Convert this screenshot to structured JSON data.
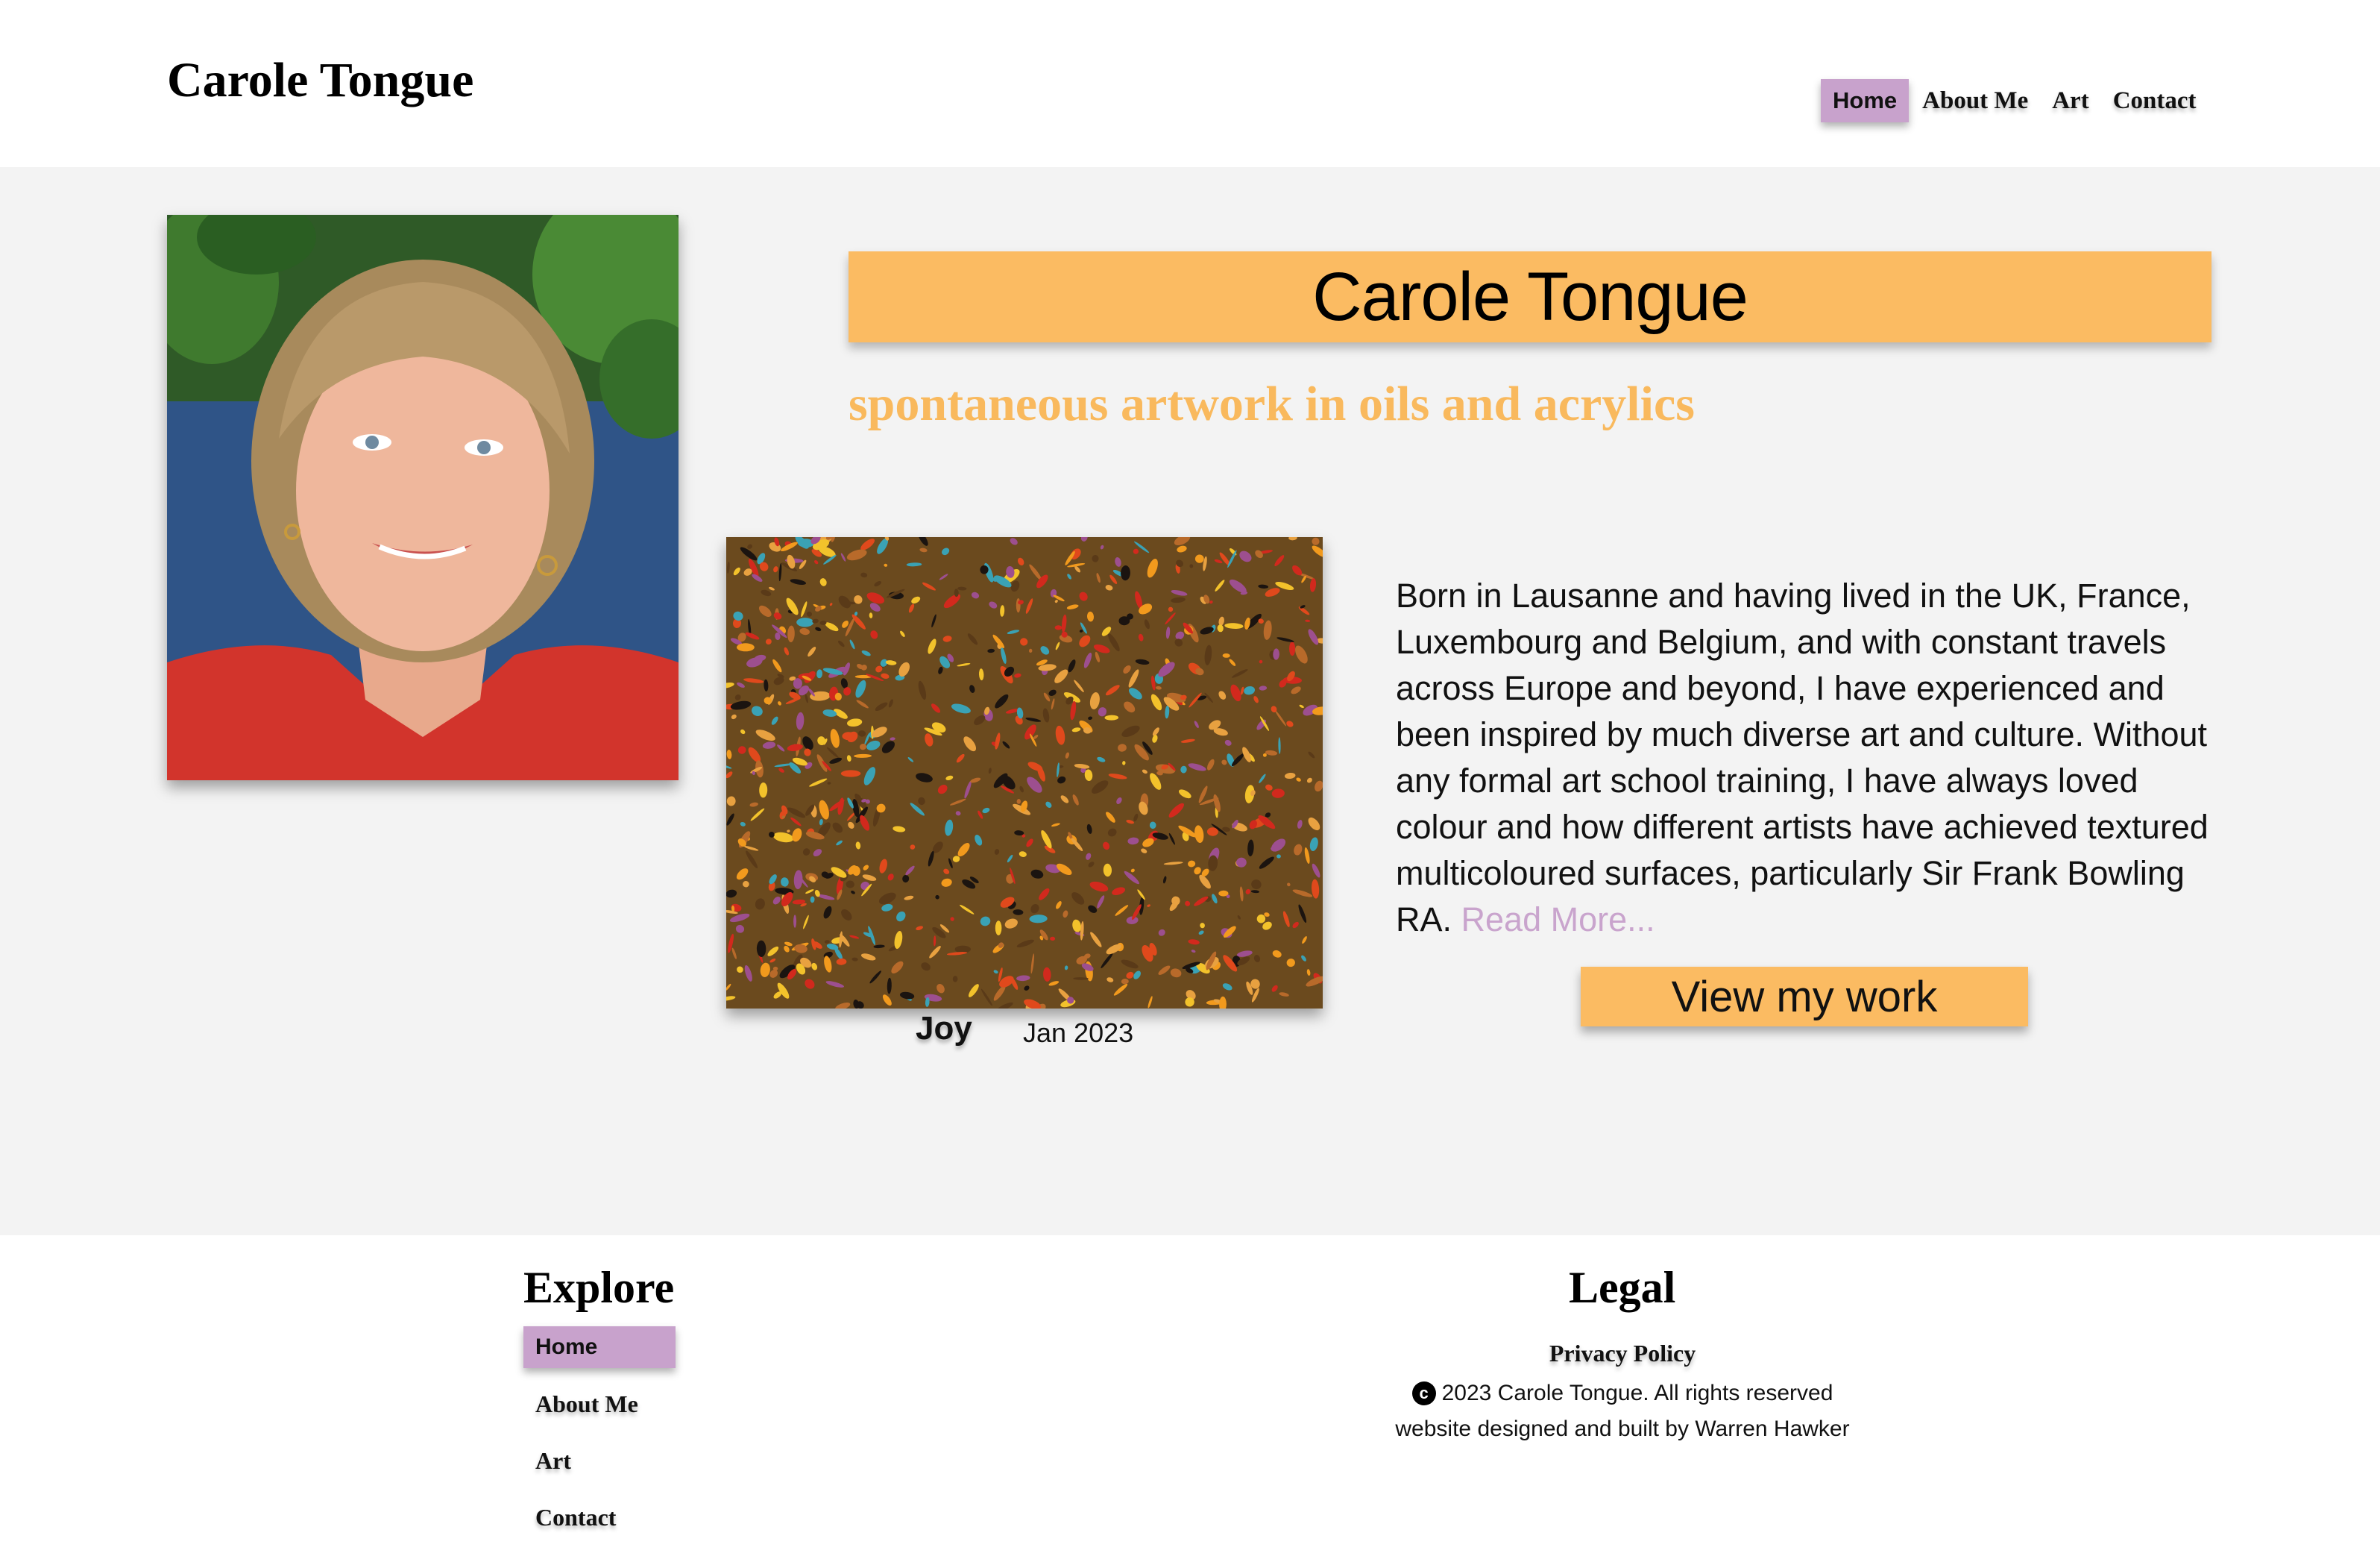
{
  "header": {
    "site_title": "Carole Tongue",
    "nav": [
      "Home",
      "About Me",
      "Art",
      "Contact"
    ],
    "active_nav": "Home"
  },
  "hero": {
    "name": "Carole Tongue",
    "tagline": "spontaneous artwork in oils and acrylics"
  },
  "featured_art": {
    "title": "Joy",
    "date": "Jan 2023"
  },
  "bio": {
    "text": "Born in Lausanne and having lived in the UK, France, Luxembourg and Belgium, and with constant travels across Europe and beyond, I have experienced and been inspired by much diverse art and culture. Without any formal art school training, I have always loved colour and how different artists have achieved textured multicoloured surfaces, particularly Sir Frank Bowling RA.",
    "read_more": "Read More..."
  },
  "cta": {
    "view_work": "View my work"
  },
  "footer": {
    "explore_heading": "Explore",
    "explore_links": [
      "Home",
      "About Me",
      "Art",
      "Contact"
    ],
    "legal_heading": "Legal",
    "privacy": "Privacy Policy",
    "copyright": "2023 Carole Tongue. All rights reserved",
    "credit": "website designed and built by Warren Hawker"
  },
  "colors": {
    "accent_orange": "#fbbb62",
    "tagline_orange": "#f9b95d",
    "accent_purple": "#c8a2cc",
    "main_bg": "#f3f3f3"
  }
}
